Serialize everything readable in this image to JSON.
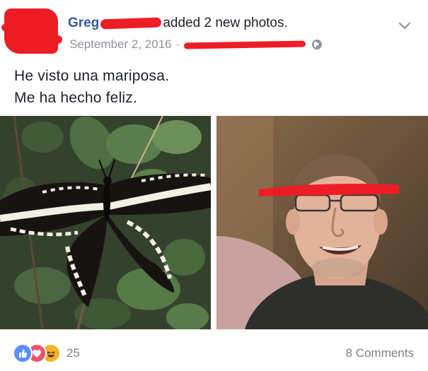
{
  "post": {
    "author": "Greg",
    "action": "added 2 new photos.",
    "date": "September 2, 2016",
    "separator": "·",
    "privacy_icon": "globe-icon",
    "menu_icon": "chevron-down-icon",
    "message": [
      "He visto una mariposa.",
      "Me ha hecho feliz."
    ]
  },
  "photos": [
    {
      "subject": "butterfly-photo"
    },
    {
      "subject": "selfie-photo"
    }
  ],
  "footer": {
    "reaction_icons": [
      "like-icon",
      "love-icon",
      "haha-icon"
    ],
    "reaction_count": "25",
    "comments_label": "8 Comments"
  },
  "colors": {
    "redaction": "#ee1d25",
    "author_link": "#365899",
    "meta_gray": "#90949c",
    "like_blue": "#5890ff",
    "love_red": "#f25268",
    "haha_yellow": "#f7b125"
  }
}
